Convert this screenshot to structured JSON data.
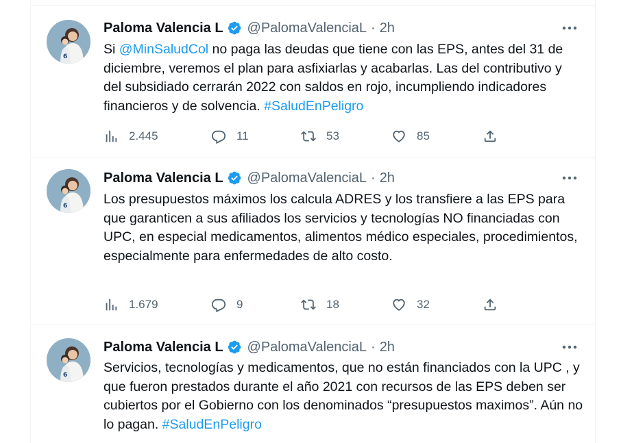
{
  "tweets": [
    {
      "author_name": "Paloma Valencia L",
      "handle": "@PalomaValenciaL",
      "separator": "·",
      "time": "2h",
      "body": [
        {
          "text": "Si ",
          "link": false
        },
        {
          "text": "@MinSaludCol",
          "link": true
        },
        {
          "text": " no paga las deudas que tiene con las EPS, antes del 31 de diciembre, veremos el plan para asfixiarlas y acabarlas. Las del contributivo y del subsidiado cerrarán 2022 con saldos en rojo, incumpliendo indicadores financieros y de solvencia. ",
          "link": false
        },
        {
          "text": "#SaludEnPeligro",
          "link": true
        }
      ],
      "views": "2.445",
      "replies": "11",
      "retweets": "53",
      "likes": "85"
    },
    {
      "author_name": "Paloma Valencia L",
      "handle": "@PalomaValenciaL",
      "separator": "·",
      "time": "2h",
      "body": [
        {
          "text": "Los presupuestos máximos los calcula  ADRES y los transfiere a las EPS para que garanticen a sus afiliados los servicios y tecnologías NO financiadas con UPC, en especial medicamentos, alimentos médico especiales, procedimientos, especialmente para enfermedades de alto costo.",
          "link": false
        }
      ],
      "views": "1.679",
      "replies": "9",
      "retweets": "18",
      "likes": "32"
    },
    {
      "author_name": "Paloma Valencia L",
      "handle": "@PalomaValenciaL",
      "separator": "·",
      "time": "2h",
      "body": [
        {
          "text": "Servicios, tecnologías y medicamentos, que no están financiados con la UPC , y que fueron prestados durante el año 2021 con recursos de las EPS deben ser cubiertos por el Gobierno con los denominados “presupuestos maximos”. Aún no lo pagan. ",
          "link": false
        },
        {
          "text": "#SaludEnPeligro",
          "link": true
        }
      ]
    }
  ],
  "icons": {
    "verified": "verified-badge-icon",
    "more": "more-options-icon",
    "views": "analytics-icon",
    "reply": "reply-icon",
    "retweet": "retweet-icon",
    "like": "heart-icon",
    "share": "share-icon"
  },
  "colors": {
    "link": "#1d9bf0",
    "secondary_text": "#536471",
    "verified": "#1d9bf0"
  }
}
